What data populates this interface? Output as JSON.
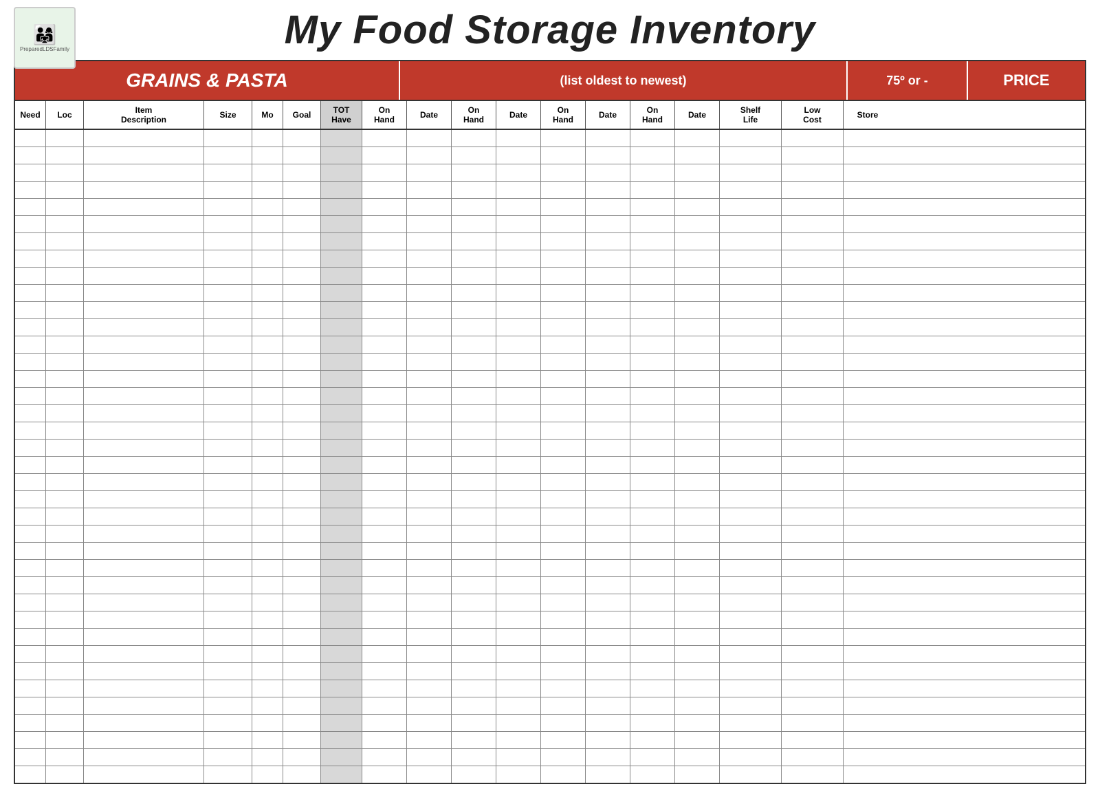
{
  "header": {
    "title": "My Food Storage Inventory",
    "logo_text": "PreparedLDSFamily",
    "logo_emoji": "👨‍👩‍👧‍👦"
  },
  "section": {
    "title": "GRAINS & PASTA",
    "subtitle": "(list oldest to newest)",
    "temp": "75º or -",
    "price": "PRICE"
  },
  "columns": [
    {
      "label": "Need",
      "shaded": false
    },
    {
      "label": "Loc",
      "shaded": false
    },
    {
      "label": "Item\nDescription",
      "shaded": false
    },
    {
      "label": "Size",
      "shaded": false
    },
    {
      "label": "Mo",
      "shaded": false
    },
    {
      "label": "Goal",
      "shaded": false
    },
    {
      "label": "TOT\nHave",
      "shaded": true
    },
    {
      "label": "On\nHand",
      "shaded": false
    },
    {
      "label": "Date",
      "shaded": false
    },
    {
      "label": "On\nHand",
      "shaded": false
    },
    {
      "label": "Date",
      "shaded": false
    },
    {
      "label": "On\nHand",
      "shaded": false
    },
    {
      "label": "Date",
      "shaded": false
    },
    {
      "label": "On\nHand",
      "shaded": false
    },
    {
      "label": "Date",
      "shaded": false
    },
    {
      "label": "Shelf\nLife",
      "shaded": false
    },
    {
      "label": "Low\nCost",
      "shaded": false
    },
    {
      "label": "Store",
      "shaded": false
    }
  ],
  "num_rows": 38
}
